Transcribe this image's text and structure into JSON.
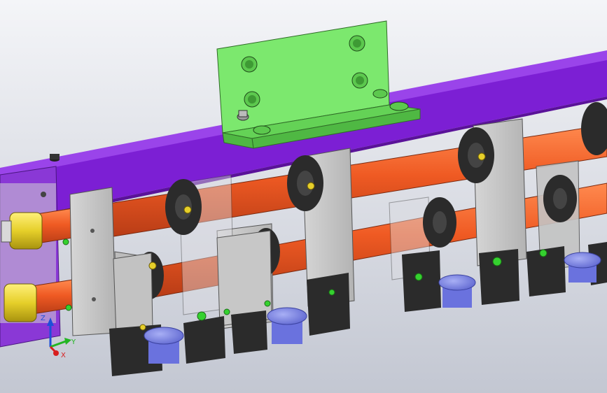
{
  "viewport": {
    "background_top": "#f4f5f8",
    "background_bottom": "#c3c7d2"
  },
  "colors": {
    "rail": "#7c1fd4",
    "rail_top": "#9a44ea",
    "bracket": "#7ce86e",
    "bracket_shade": "#5cc84e",
    "shaft": "#ef5a23",
    "shaft_shade": "#c9421a",
    "block": "#c9c9c9",
    "block_shade": "#a9a9a9",
    "clamp": "#2b2b2b",
    "fitting": "#e6cf2a",
    "cap": "#7e86e8",
    "green_screw": "#35d12f"
  },
  "triad": {
    "x_label": "X",
    "y_label": "Y",
    "z_label": "Z",
    "x_color": "#d81e1e",
    "y_color": "#22b522",
    "z_color": "#1e4fd8"
  }
}
